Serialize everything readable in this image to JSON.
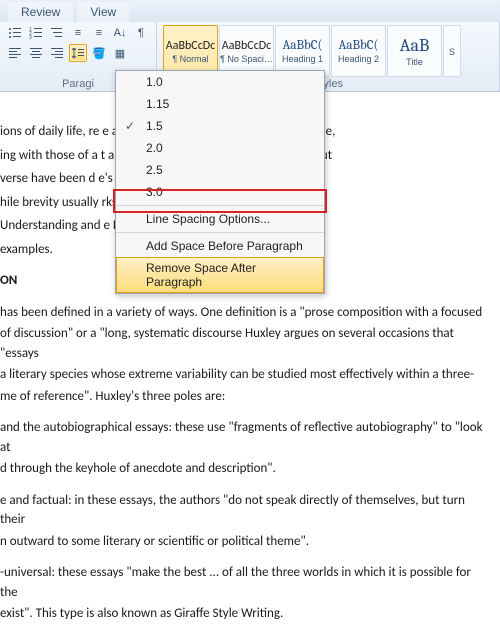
{
  "tabs": {
    "review": "Review",
    "view": "View"
  },
  "ribbon": {
    "paragraph_label": "Paragi",
    "styles_label": "Styles",
    "style_preview": "AaBbCcDc",
    "style_preview_h": "AaBbC(",
    "style_preview_t": "AaB",
    "styles": {
      "normal": "¶ Normal",
      "nospacing": "¶ No Spaci…",
      "heading1": "Heading 1",
      "heading2": "Heading 2",
      "title": "Title",
      "subtitle": "S"
    }
  },
  "spacing_menu": {
    "v10": "1.0",
    "v115": "1.15",
    "v15": "1.5",
    "v20": "2.0",
    "v25": "2.5",
    "v30": "3.0",
    "options": "Line Spacing Options...",
    "add_before": "Add Space Before Paragraph",
    "remove_after": "Remove Space After Paragraph"
  },
  "doc": {
    "p1": "ions of daily life, re                                                         e author. The definition of an essay is vague,",
    "p2": "ing with those of a                                                             t all modern essays are written in prose, but",
    "p3": "verse have been d                                                              e's An Essay on Criticism and An Essay on",
    "p4": "hile brevity usually                                                           rks like John Locke's An Essay Concerning",
    "p5": "Understanding and                                                            e Principle of Population are",
    "p6": "examples.",
    "h1": "ON",
    "p7": "has been defined in a variety of ways. One definition is a \"prose composition with a focused",
    "p8": "of discussion\" or a \"long, systematic discourse Huxley argues on several occasions that \"essays",
    "p9": "a literary species whose extreme variability can be studied most effectively within a three-",
    "p10": "me of reference\". Huxley's three poles are:",
    "p11": "and the autobiographical essays: these use \"fragments of reflective autobiography\" to \"look at",
    "p12": "d through the keyhole of anecdote and description\".",
    "p13": "e and factual: in these essays, the authors \"do not speak directly of themselves, but turn their",
    "p14": "n outward to some literary or scientific or political theme\".",
    "p15": "-universal: these essays \"make the best ... of all the three worlds in which it is possible for the",
    "p16": "exist\". This type is also known as Giraffe Style Writing."
  }
}
